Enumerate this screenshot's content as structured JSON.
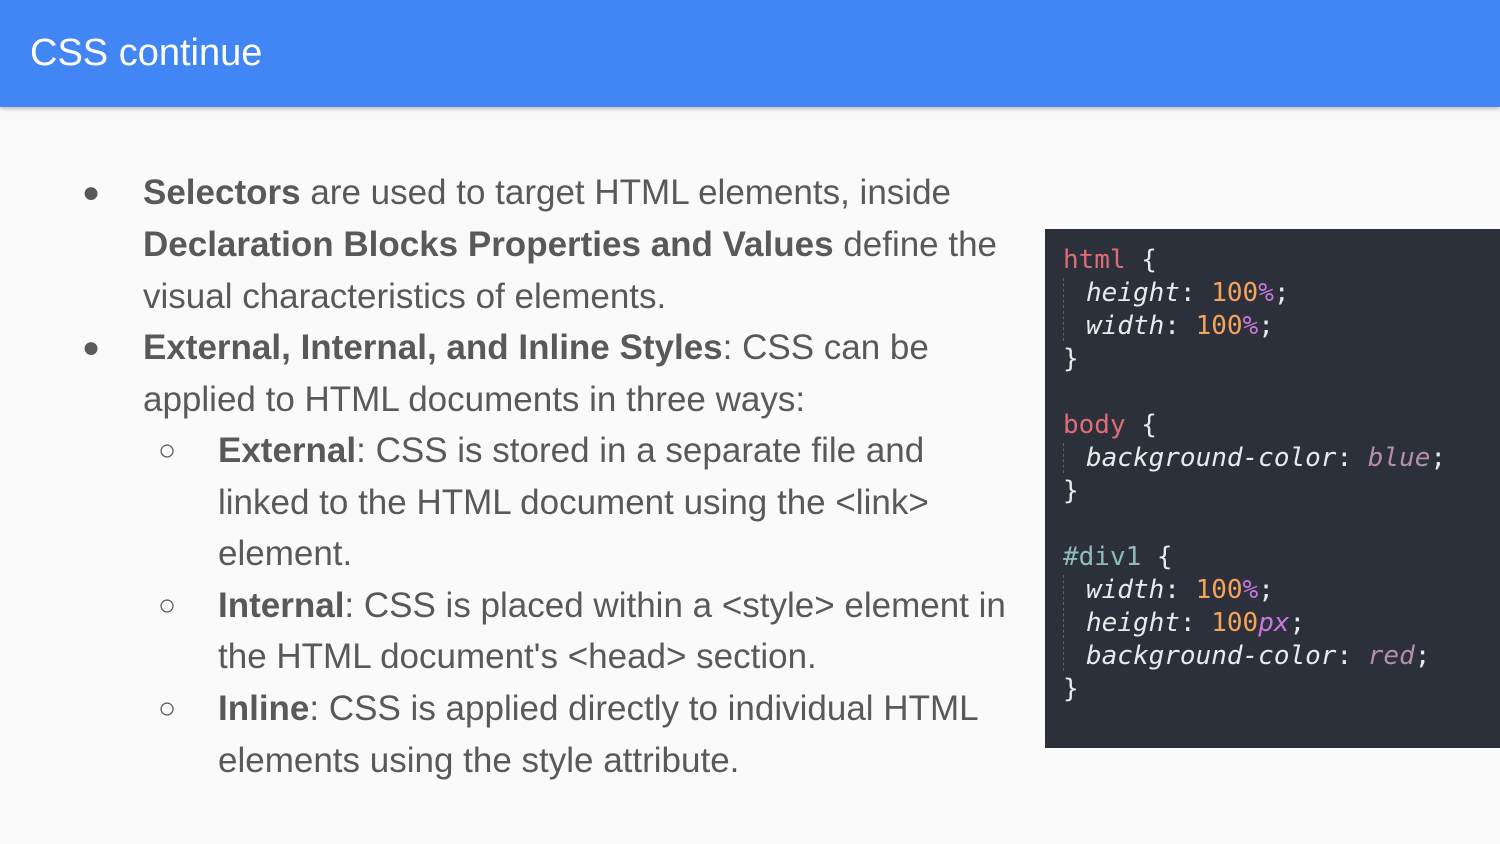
{
  "slide": {
    "title": "CSS continue"
  },
  "bullets": {
    "b1": {
      "bullet": "●",
      "l1_bold": "Selectors",
      "l1_rest": " are used to target HTML elements, inside",
      "l2_bold": "Declaration Blocks Properties and Values",
      "l2_rest": " define the",
      "l3": "visual characteristics of elements."
    },
    "b2": {
      "bullet": "●",
      "l1_bold": "External, Internal, and Inline Styles",
      "l1_rest": ": CSS can be",
      "l2": "applied to HTML documents in three ways:"
    },
    "s1": {
      "bullet": "○",
      "l1_bold": "External",
      "l1_rest": ": CSS is stored in a separate file and",
      "l2": "linked to the HTML document using the <link>",
      "l3": "element."
    },
    "s2": {
      "bullet": "○",
      "l1_bold": "Internal",
      "l1_rest": ": CSS is placed within a <style> element in",
      "l2": "the HTML document's <head> section."
    },
    "s3": {
      "bullet": "○",
      "l1_bold": "Inline",
      "l1_rest": ": CSS is applied directly to individual HTML",
      "l2": "elements using the style attribute."
    }
  },
  "code": {
    "html_sel": "html",
    "open": " {",
    "close": "}",
    "height": "height",
    "width": "width",
    "colon": ": ",
    "semi": ";",
    "n100": "100",
    "pct": "%",
    "px": "px",
    "body_sel": "body",
    "bgcolor": "background-color",
    "blue": "blue",
    "div_sel": "#div1",
    "red": "red"
  },
  "colors": {
    "header": "#4285f4",
    "code_bg": "#2b303b",
    "text": "#595959"
  }
}
